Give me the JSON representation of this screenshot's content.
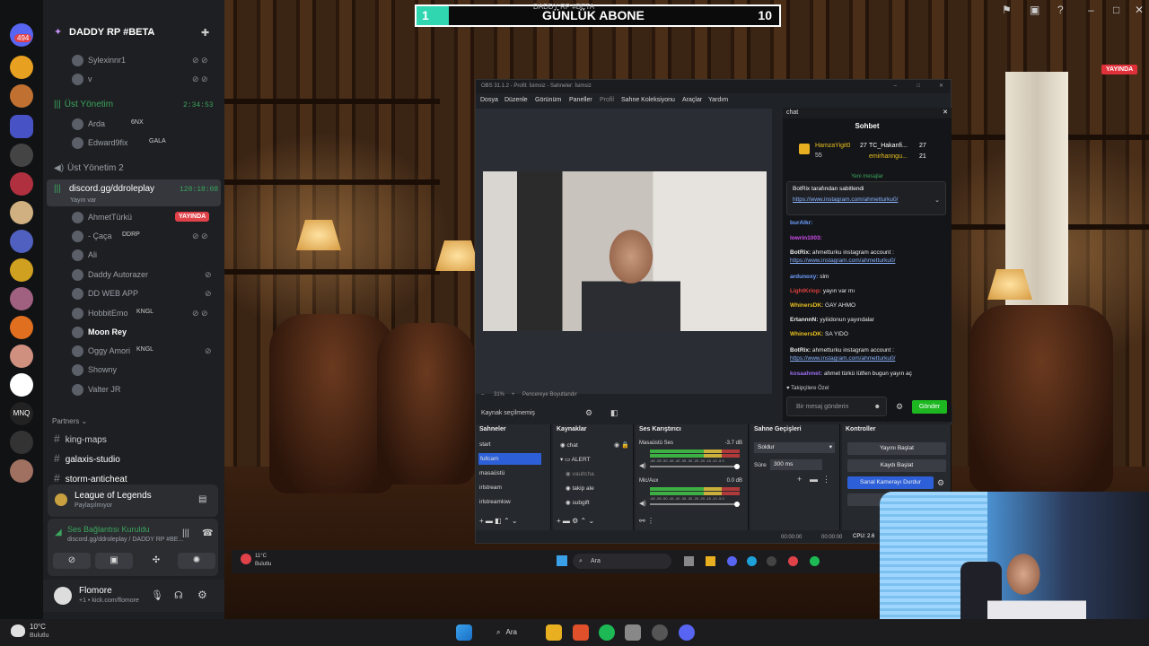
{
  "top_counter": {
    "left_value": "1",
    "title": "GÜNLÜK ABONE",
    "subtitle": "DADDY RP #BETA",
    "right_value": "10"
  },
  "stream_live_badge": "YAYINDA",
  "discord": {
    "server_badge": "494",
    "guild_name": "DADDY RP #BETA",
    "members_top": [
      {
        "name": "Sylexinnr1"
      },
      {
        "name": "v"
      }
    ],
    "voice_channels": [
      {
        "name": "Üst Yönetim",
        "timer": "2:34:53"
      },
      {
        "name": "Üst Yönetim 2"
      },
      {
        "name": "discord.gg/ddroleplay",
        "timer": "128:18:08",
        "subtitle": "Yayın var"
      }
    ],
    "ust_members": [
      {
        "name": "Arda",
        "tag": "6NX"
      },
      {
        "name": "Edward9fix",
        "tag": "GALA"
      }
    ],
    "dd_members": [
      {
        "name": "AhmetTürkü",
        "badge": "YAYINDA"
      },
      {
        "name": "- Çaça",
        "tag": "DDRP"
      },
      {
        "name": "Ali"
      },
      {
        "name": "Daddy Autorazer"
      },
      {
        "name": "DD WEB APP"
      },
      {
        "name": "HobbitEmo",
        "tag": "KNGL"
      },
      {
        "name": "Moon Rey"
      },
      {
        "name": "Oggy Amori",
        "tag": "KNGL"
      },
      {
        "name": "Showny"
      },
      {
        "name": "Valter JR"
      }
    ],
    "partners_label": "Partners",
    "text_channels": [
      "king-maps",
      "galaxis-studio",
      "storm-anticheat"
    ],
    "activity": {
      "title": "League of Legends",
      "subtitle": "Paylaşılmıyor"
    },
    "voice_status": {
      "title": "Ses Bağlantısı Kuruldu",
      "subtitle": "discord.gg/ddroleplay / DADDY RP #BE..."
    },
    "user": {
      "name": "Flomore",
      "status": "+1 • kick.com/flomore"
    }
  },
  "obs": {
    "title": "OBS 31.1.2 - Profil: İsimsiz - Sahneler: İsimsiz",
    "menu": [
      "Dosya",
      "Düzenle",
      "Görünüm",
      "Paneller",
      "Profil",
      "Sahne Koleksiyonu",
      "Araçlar",
      "Yardım"
    ],
    "zoom": "31%",
    "fit_label": "Pencereye Boyutlandır",
    "source_status": "Kaynak seçilmemiş",
    "scenes_header": "Sahneler",
    "scenes": [
      "start",
      "fullcam",
      "masaüstü",
      "irlstream",
      "irlstreamlow"
    ],
    "selected_scene": "fullcam",
    "sources_header": "Kaynaklar",
    "sources": [
      "chat",
      "ALERT",
      "vaultcha",
      "takip ale",
      "subgift"
    ],
    "mixer_header": "Ses Karıştırıcı",
    "mixer": [
      {
        "name": "Masaüstü Ses",
        "db": "-3.7 dB"
      },
      {
        "name": "Mic/Aux",
        "db": "0.0 dB"
      }
    ],
    "meter_scale": "-60 -55 -50 -45 -40 -35 -30 -25 -20 -15 -10 -5 0",
    "transitions_header": "Sahne Geçişleri",
    "transition": "Soldur",
    "duration_label": "Süre",
    "duration": "300 ms",
    "controls_header": "Kontroller",
    "controls": [
      "Yayını Başlat",
      "Kaydı Başlat",
      "Sanal Kamerayı Durdur",
      "St"
    ],
    "status": {
      "t1": "00:00:00",
      "t2": "00:00:00",
      "cpu": "CPU: 2.6"
    },
    "chat": {
      "dock_title": "chat",
      "header": "Sohbet",
      "top_gifters": [
        {
          "name": "HamzaYigit0",
          "n": "27",
          "sub": "55"
        },
        {
          "name": "TC_Hakanfi...",
          "n": "27"
        },
        {
          "name": "emirhanngu...",
          "n": "21"
        }
      ],
      "new_messages": "Yeni mesajlar",
      "pinned_by": "BotRix tarafından sabitlendi",
      "pinned_link": "https://www.instagram.com/ahmetturku0/",
      "messages": [
        {
          "user": "burAlkr:",
          "text": "",
          "color": "#6ea0ff"
        },
        {
          "user": "lowrin1003:",
          "text": "",
          "color": "#d24df0"
        },
        {
          "user": "BotRix:",
          "text": "ahmetturku instagram account :",
          "color": "#e8e8e8"
        },
        {
          "user": "",
          "text": "https://www.instagram.com/ahmetturku0/",
          "color": "#8ab4ff"
        },
        {
          "user": "ardunoxy:",
          "text": "slm",
          "color": "#6ea0ff"
        },
        {
          "user": "LightKriop:",
          "text": "yayın var mı",
          "color": "#e04040"
        },
        {
          "user": "WhinersDK:",
          "text": "GAY AHMO",
          "color": "#e8c020"
        },
        {
          "user": "ErtannnN:",
          "text": "yyiiidonun yayındalar",
          "color": "#e8e8e8"
        },
        {
          "user": "WhinersDK:",
          "text": "SA YIDO",
          "color": "#e8c020"
        },
        {
          "user": "BotRix:",
          "text": "ahmetturku instagram account :",
          "color": "#e8e8e8"
        },
        {
          "user": "",
          "text": "https://www.instagram.com/ahmetturku0/",
          "color": "#8ab4ff"
        },
        {
          "user": "kosaahmet:",
          "text": "ahmet türkü lütfen bugun yayın aç",
          "color": "#9a6ef0"
        }
      ],
      "followers_label": "Takipçilere Özel",
      "input_placeholder": "Bir mesaj gönderin",
      "send": "Gönder"
    }
  },
  "inner_taskbar": {
    "weather_temp": "11°C",
    "weather_label": "Bulutlu",
    "search": "Ara"
  },
  "taskbar": {
    "weather_temp": "10°C",
    "weather_label": "Bulutlu",
    "search": "Ara"
  }
}
